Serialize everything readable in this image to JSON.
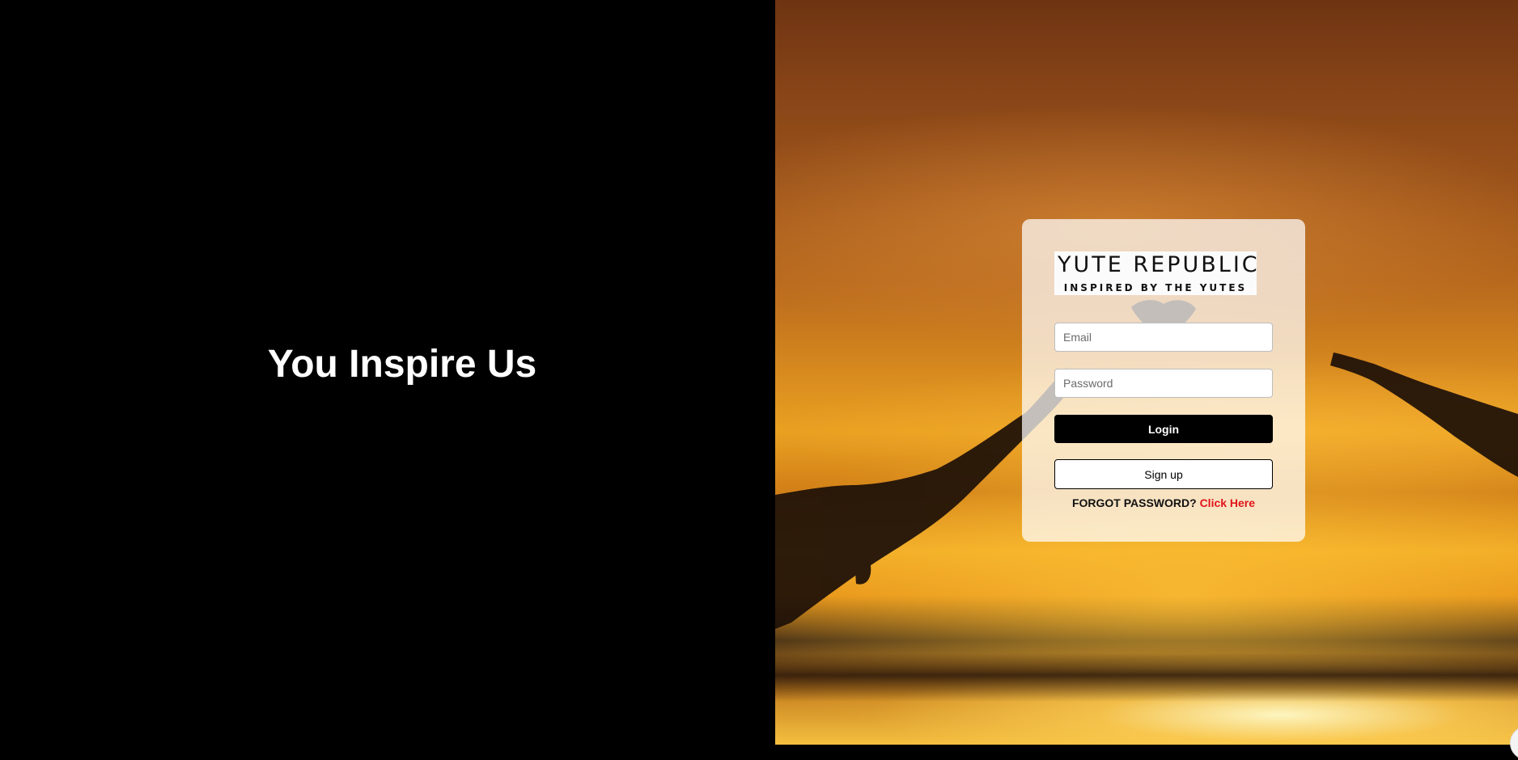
{
  "hero": {
    "tagline": "You Inspire Us"
  },
  "brand": {
    "logo_main": "YUTE REPUBLIC",
    "logo_sub": "INSPIRED BY THE YUTES"
  },
  "form": {
    "email_placeholder": "Email",
    "password_placeholder": "Password",
    "login_label": "Login",
    "signup_label": "Sign up",
    "forgot_text": "FORGOT PASSWORD?",
    "forgot_link": "Click Here"
  },
  "colors": {
    "accent_link": "#e0141a",
    "login_button": "#000000",
    "left_panel": "#000000"
  }
}
